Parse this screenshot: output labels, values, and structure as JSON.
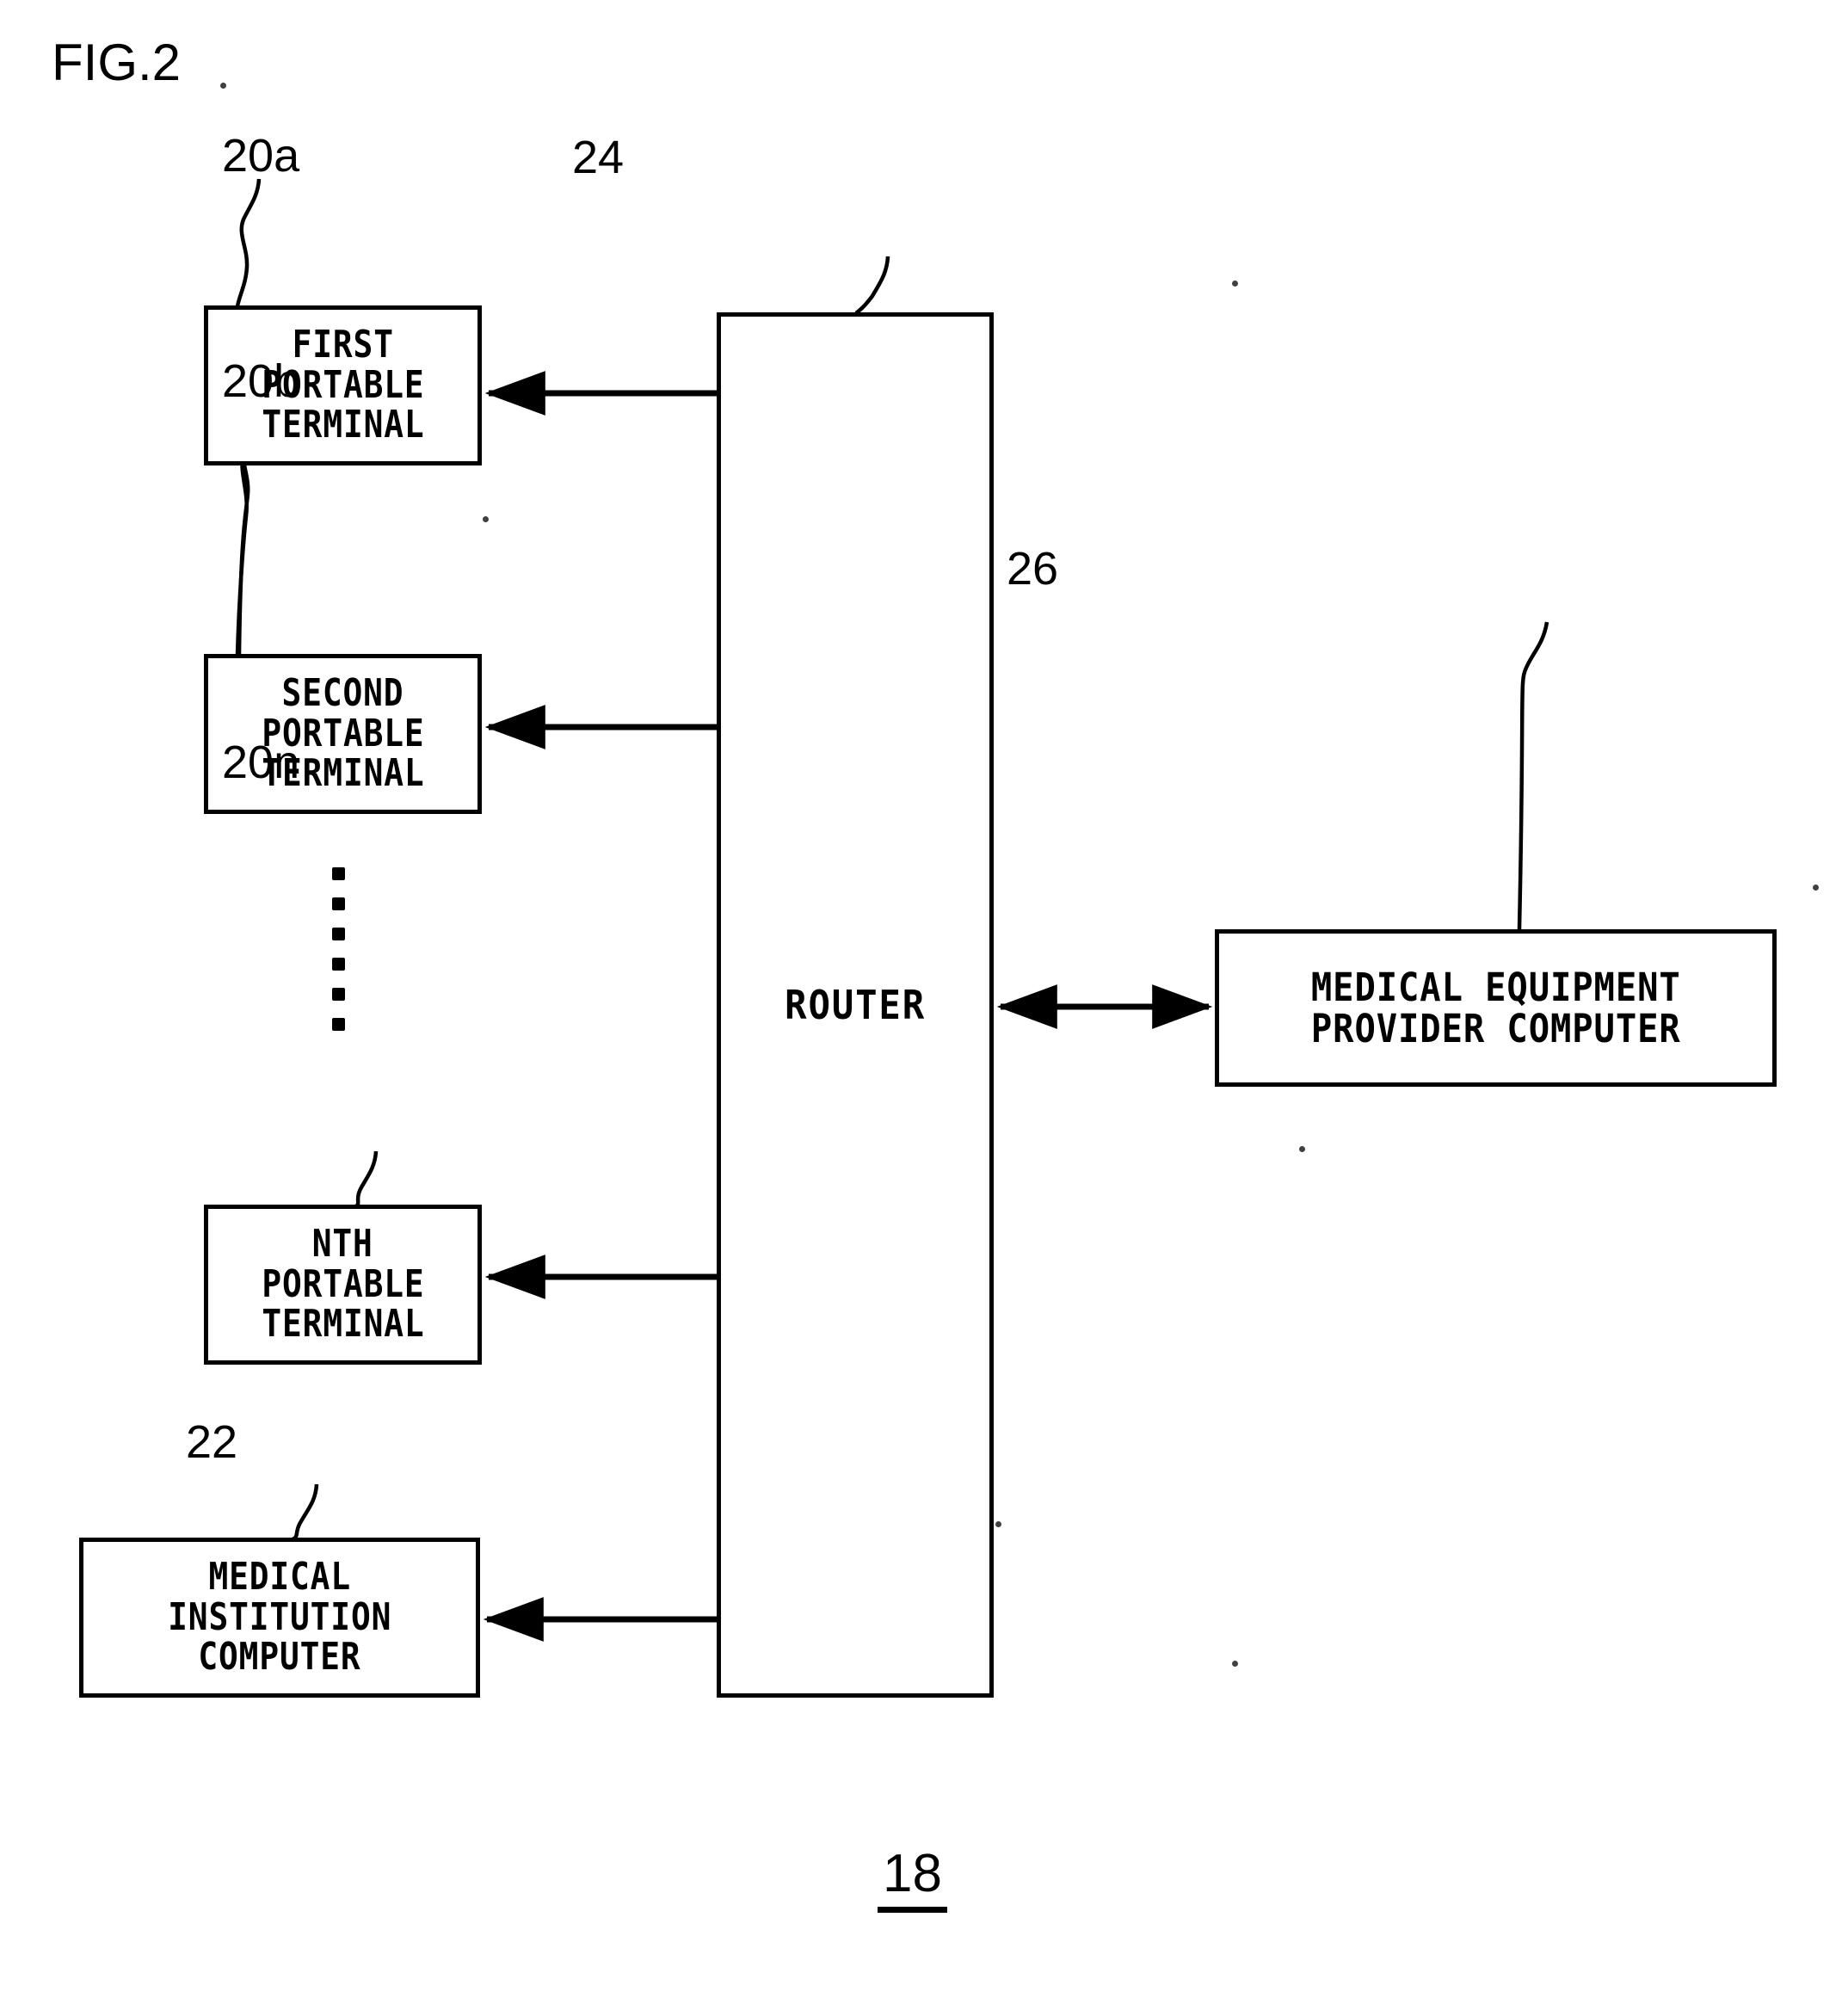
{
  "figure": {
    "title": "FIG.2",
    "number": "18"
  },
  "nodes": [
    {
      "id": "20a",
      "ref": "20a",
      "lines": [
        "FIRST",
        "PORTABLE",
        "TERMINAL"
      ]
    },
    {
      "id": "20b",
      "ref": "20b",
      "lines": [
        "SECOND",
        "PORTABLE",
        "TERMINAL"
      ]
    },
    {
      "id": "20n",
      "ref": "20n",
      "lines": [
        "NTH",
        "PORTABLE",
        "TERMINAL"
      ]
    },
    {
      "id": "22",
      "ref": "22",
      "lines": [
        "MEDICAL",
        "INSTITUTION",
        "COMPUTER"
      ]
    },
    {
      "id": "24",
      "ref": "24",
      "lines": [
        "ROUTER"
      ]
    },
    {
      "id": "26",
      "ref": "26",
      "lines": [
        "MEDICAL EQUIPMENT",
        "PROVIDER COMPUTER"
      ]
    }
  ],
  "connections": [
    {
      "id": "conn-20a-24",
      "from": "20a",
      "to": "24",
      "style": "bidirectional"
    },
    {
      "id": "conn-20b-24",
      "from": "20b",
      "to": "24",
      "style": "bidirectional"
    },
    {
      "id": "conn-20n-24",
      "from": "20n",
      "to": "24",
      "style": "bidirectional"
    },
    {
      "id": "conn-22-24",
      "from": "22",
      "to": "24",
      "style": "bidirectional"
    },
    {
      "id": "conn-24-26",
      "from": "24",
      "to": "26",
      "style": "bidirectional"
    }
  ],
  "ellipsis": {
    "id": "vertical-ellipsis",
    "dot_count": 6,
    "meaning": "additional portable terminals between second and nth"
  },
  "colors": {
    "ink": "#000000",
    "paper": "#ffffff"
  }
}
